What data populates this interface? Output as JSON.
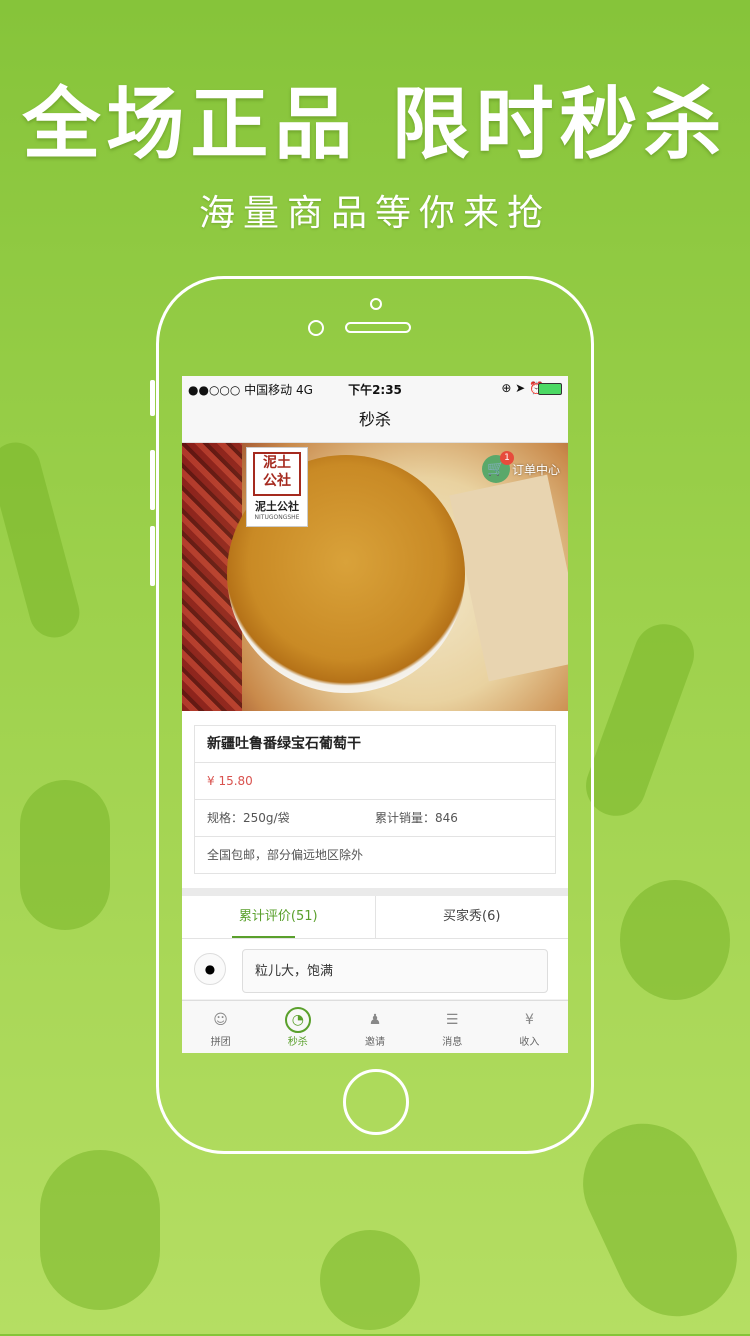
{
  "promo": {
    "headline": "全场正品  限时秒杀",
    "subline": "海量商品等你来抢"
  },
  "status_bar": {
    "carrier": "●●○○○ 中国移动  4G",
    "time": "下午2:35",
    "right_icons": "⊕ ➤ ⏰"
  },
  "nav": {
    "title": "秒杀"
  },
  "hero": {
    "brand_seal": "泥土\n公社",
    "brand_name": "泥土公社",
    "brand_en": "NITUGONGSHE",
    "order_center_label": "订单中心",
    "order_badge": "1"
  },
  "product": {
    "title": "新疆吐鲁番绿宝石葡萄干",
    "price": "¥ 15.80",
    "spec": "规格：250g/袋",
    "sales": "累计销量：846",
    "shipping": "全国包邮，部分偏远地区除外"
  },
  "tabs": [
    {
      "label": "累计评价(51)",
      "active": true
    },
    {
      "label": "买家秀(6)",
      "active": false
    }
  ],
  "review": {
    "text": "粒儿大，饱满"
  },
  "tabbar": [
    {
      "label": "拼团",
      "icon": "group-icon",
      "glyph": "☺",
      "active": false
    },
    {
      "label": "秒杀",
      "icon": "clock-icon",
      "glyph": "◔",
      "active": true
    },
    {
      "label": "邀请",
      "icon": "add-user-icon",
      "glyph": "♟",
      "active": false
    },
    {
      "label": "消息",
      "icon": "message-icon",
      "glyph": "☰",
      "active": false
    },
    {
      "label": "收入",
      "icon": "money-bag-icon",
      "glyph": "¥",
      "active": false
    }
  ],
  "colors": {
    "background": "#8fc840",
    "accent": "#5aa02c",
    "price": "#d9534f"
  }
}
